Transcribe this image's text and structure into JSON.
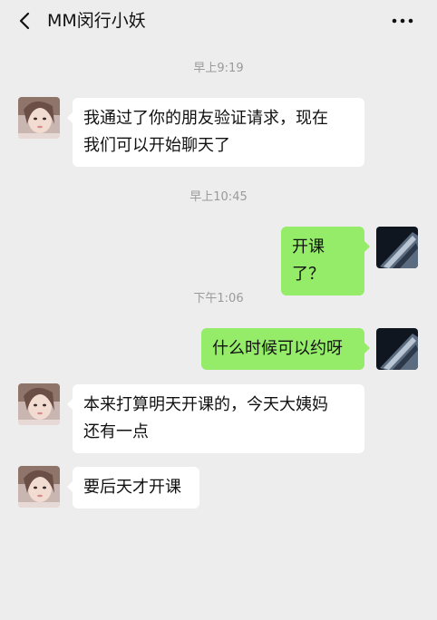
{
  "header": {
    "title": "MM闵行小妖",
    "back_icon": "chevron-left-icon",
    "more_icon": "more-horizontal-icon"
  },
  "messages": [
    {
      "type": "time",
      "text": "早上9:19"
    },
    {
      "type": "msg",
      "side": "left",
      "text": "我通过了你的朋友验证请求，现在\n我们可以开始聊天了"
    },
    {
      "type": "time",
      "text": "早上10:45"
    },
    {
      "type": "msg",
      "side": "right",
      "text": "开课了？"
    },
    {
      "type": "time",
      "text": "下午1:06"
    },
    {
      "type": "msg",
      "side": "right",
      "text": "什么时候可以约呀"
    },
    {
      "type": "msg",
      "side": "left",
      "text": "本来打算明天开课的，今天大姨妈\n还有一点"
    },
    {
      "type": "msg",
      "side": "left",
      "text": "要后天才开课"
    }
  ],
  "colors": {
    "background": "#ededed",
    "incoming_bubble": "#ffffff",
    "outgoing_bubble": "#95ec69",
    "timestamp": "#9a9a9a"
  }
}
